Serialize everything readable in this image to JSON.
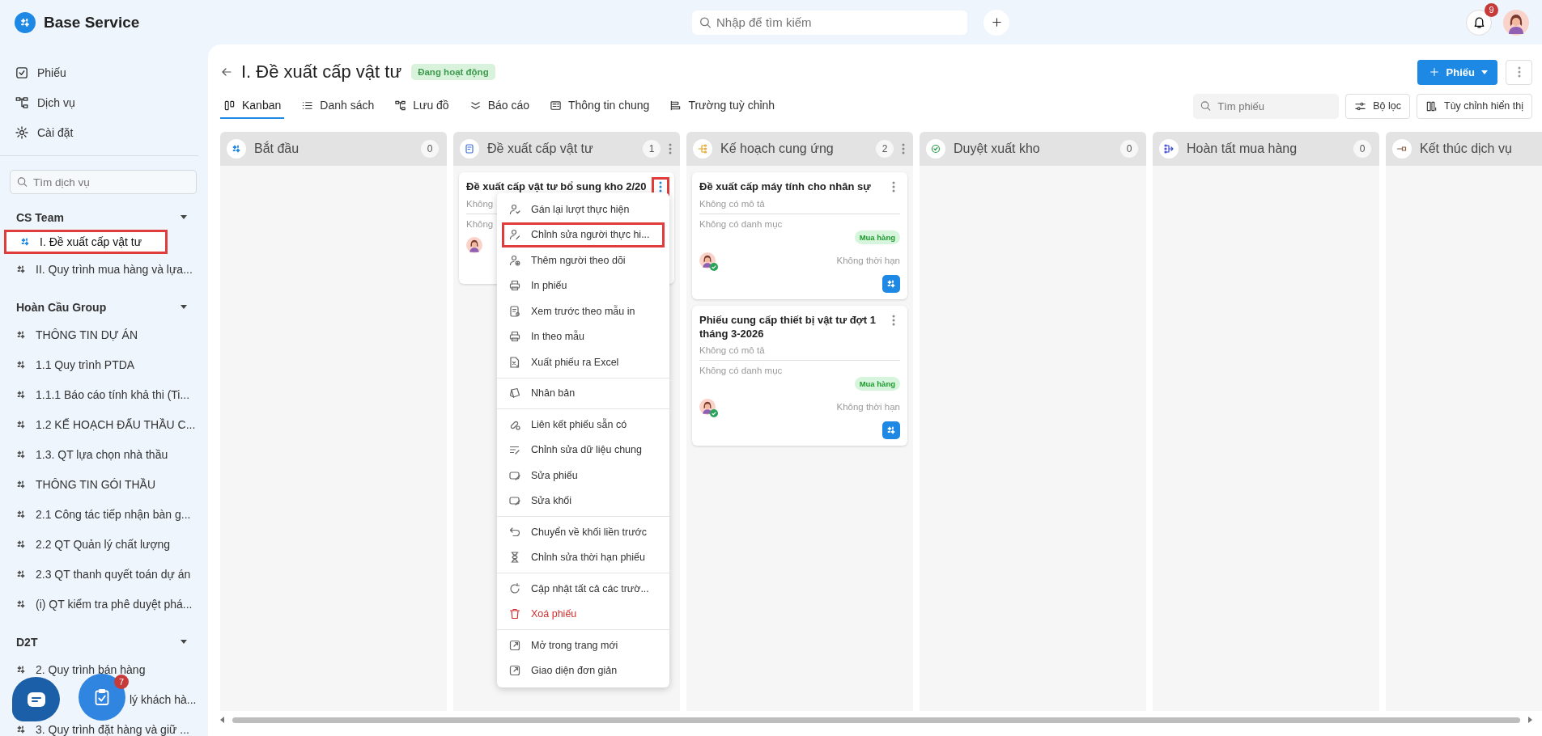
{
  "app": {
    "name": "Base Service"
  },
  "topbar": {
    "search_placeholder": "Nhập để tìm kiếm",
    "notifications": "9"
  },
  "sidebar": {
    "nav": [
      {
        "label": "Phiếu",
        "kind": "ticket"
      },
      {
        "label": "Dịch vụ",
        "kind": "flow"
      },
      {
        "label": "Cài đặt",
        "kind": "settings"
      }
    ],
    "search_placeholder": "Tìm dịch vụ",
    "groups": [
      {
        "name": "CS Team",
        "expanded": true,
        "items": [
          {
            "label": "I. Đề xuất cấp vật tư",
            "kind": "service",
            "selected": true,
            "highlighted": true
          },
          {
            "label": "II. Quy trình mua hàng và lựa...",
            "kind": "service",
            "selected": false,
            "highlighted": false
          }
        ]
      },
      {
        "name": "Hoàn Cầu Group",
        "expanded": true,
        "items": [
          {
            "label": "THÔNG TIN DỰ ÁN",
            "kind": "service",
            "selected": false,
            "highlighted": false
          },
          {
            "label": "1.1 Quy trình PTDA",
            "kind": "service",
            "selected": false,
            "highlighted": false
          },
          {
            "label": "1.1.1 Báo cáo tính khả thi (Ti...",
            "kind": "service",
            "selected": false,
            "highlighted": false
          },
          {
            "label": "1.2 KẾ HOẠCH ĐẤU THẦU C...",
            "kind": "service",
            "selected": false,
            "highlighted": false
          },
          {
            "label": "1.3. QT lựa chọn nhà thầu",
            "kind": "service",
            "selected": false,
            "highlighted": false
          },
          {
            "label": "THÔNG TIN GÓI THẦU",
            "kind": "service",
            "selected": false,
            "highlighted": false
          },
          {
            "label": "2.1 Công tác tiếp nhận bàn g...",
            "kind": "service",
            "selected": false,
            "highlighted": false
          },
          {
            "label": "2.2 QT Quản lý chất lượng",
            "kind": "service",
            "selected": false,
            "highlighted": false
          },
          {
            "label": "2.3 QT thanh quyết toán dự án",
            "kind": "service",
            "selected": false,
            "highlighted": false
          },
          {
            "label": "(i) QT kiểm tra phê duyệt phá...",
            "kind": "service",
            "selected": false,
            "highlighted": false
          }
        ]
      },
      {
        "name": "D2T",
        "expanded": true,
        "items": [
          {
            "label": "2. Quy trình bán hàng",
            "kind": "service",
            "selected": false,
            "highlighted": false
          },
          {
            "label": "lý khách hà...",
            "kind": "covered",
            "selected": false,
            "highlighted": false
          },
          {
            "label": "3. Quy trình đặt hàng và giữ ...",
            "kind": "service",
            "selected": false,
            "highlighted": false
          }
        ]
      }
    ]
  },
  "floating": {
    "tasks_badge": "7"
  },
  "page": {
    "title": "I. Đề xuất cấp vật tư",
    "status": "Đang hoạt động",
    "new_button": "Phiếu",
    "tabs": [
      {
        "label": "Kanban",
        "kind": "kanban",
        "selected": true
      },
      {
        "label": "Danh sách",
        "kind": "list",
        "selected": false
      },
      {
        "label": "Lưu đồ",
        "kind": "flow",
        "selected": false
      },
      {
        "label": "Báo cáo",
        "kind": "report",
        "selected": false
      },
      {
        "label": "Thông tin chung",
        "kind": "info",
        "selected": false
      },
      {
        "label": "Trường tuỳ chỉnh",
        "kind": "fields",
        "selected": false
      }
    ],
    "search_placeholder": "Tìm phiếu",
    "filter_button": "Bộ lọc",
    "customize_button": "Tùy chỉnh hiển thị"
  },
  "columns": [
    {
      "name": "Bắt đầu",
      "count": "0",
      "kind": "start"
    },
    {
      "name": "Đề xuất cấp vật tư",
      "count": "1",
      "kind": "form",
      "cards": [
        {
          "title": "Đề xuất cấp vật tư bổ sung kho 2/20",
          "description": "Không",
          "category": "Không",
          "assignee_done": false,
          "highlighted": true,
          "menu": [
            [
              {
                "label": "Gán lại lượt thực hiện",
                "kind": "user-repeat",
                "danger": false,
                "highlighted": false
              },
              {
                "label": "Chỉnh sửa người thực hi...",
                "kind": "user-edit",
                "danger": false,
                "highlighted": true
              },
              {
                "label": "Thêm người theo dõi",
                "kind": "user-add",
                "danger": false,
                "highlighted": false
              },
              {
                "label": "In phiếu",
                "kind": "print",
                "danger": false,
                "highlighted": false
              },
              {
                "label": "Xem trước theo mẫu in",
                "kind": "preview",
                "danger": false,
                "highlighted": false
              },
              {
                "label": "In theo mẫu",
                "kind": "print",
                "danger": false,
                "highlighted": false
              },
              {
                "label": "Xuất phiếu ra Excel",
                "kind": "excel",
                "danger": false,
                "highlighted": false
              }
            ],
            [
              {
                "label": "Nhân bản",
                "kind": "copy",
                "danger": false,
                "highlighted": false
              }
            ],
            [
              {
                "label": "Liên kết phiếu sẵn có",
                "kind": "link",
                "danger": false,
                "highlighted": false
              },
              {
                "label": "Chỉnh sửa dữ liệu chung",
                "kind": "edit-lines",
                "danger": false,
                "highlighted": false
              },
              {
                "label": "Sửa phiếu",
                "kind": "edit",
                "danger": false,
                "highlighted": false
              },
              {
                "label": "Sửa khối",
                "kind": "edit",
                "danger": false,
                "highlighted": false
              }
            ],
            [
              {
                "label": "Chuyển về khối liền trước",
                "kind": "undo",
                "danger": false,
                "highlighted": false
              },
              {
                "label": "Chỉnh sửa thời hạn phiếu",
                "kind": "hourglass",
                "danger": false,
                "highlighted": false
              }
            ],
            [
              {
                "label": "Cập nhật tất cả các trườ...",
                "kind": "refresh",
                "danger": false,
                "highlighted": false
              },
              {
                "label": "Xoá phiếu",
                "kind": "trash",
                "danger": true,
                "highlighted": false
              }
            ],
            [
              {
                "label": "Mở trong trang mới",
                "kind": "external",
                "danger": false,
                "highlighted": false
              },
              {
                "label": "Giao diện đơn giản",
                "kind": "external",
                "danger": false,
                "highlighted": false
              }
            ]
          ]
        }
      ]
    },
    {
      "name": "Kế hoạch cung ứng",
      "count": "2",
      "kind": "tree",
      "cards": [
        {
          "title": "Đề xuất cấp máy tính cho nhân sự",
          "description": "Không có mô tả",
          "category": "Không có danh mục",
          "tag": "Mua hàng",
          "deadline": "Không thời hạn",
          "assignee_done": true,
          "highlighted": false
        },
        {
          "title": "Phiếu cung cấp thiết bị vật tư đợt 1 tháng 3-2026",
          "description": "Không có mô tả",
          "category": "Không có danh mục",
          "tag": "Mua hàng",
          "deadline": "Không thời hạn",
          "assignee_done": true,
          "highlighted": false
        }
      ]
    },
    {
      "name": "Duyệt xuất kho",
      "count": "0",
      "kind": "check"
    },
    {
      "name": "Hoàn tất mua hàng",
      "count": "0",
      "kind": "merge"
    },
    {
      "name": "Kết thúc dịch vụ",
      "kind": "end"
    }
  ]
}
